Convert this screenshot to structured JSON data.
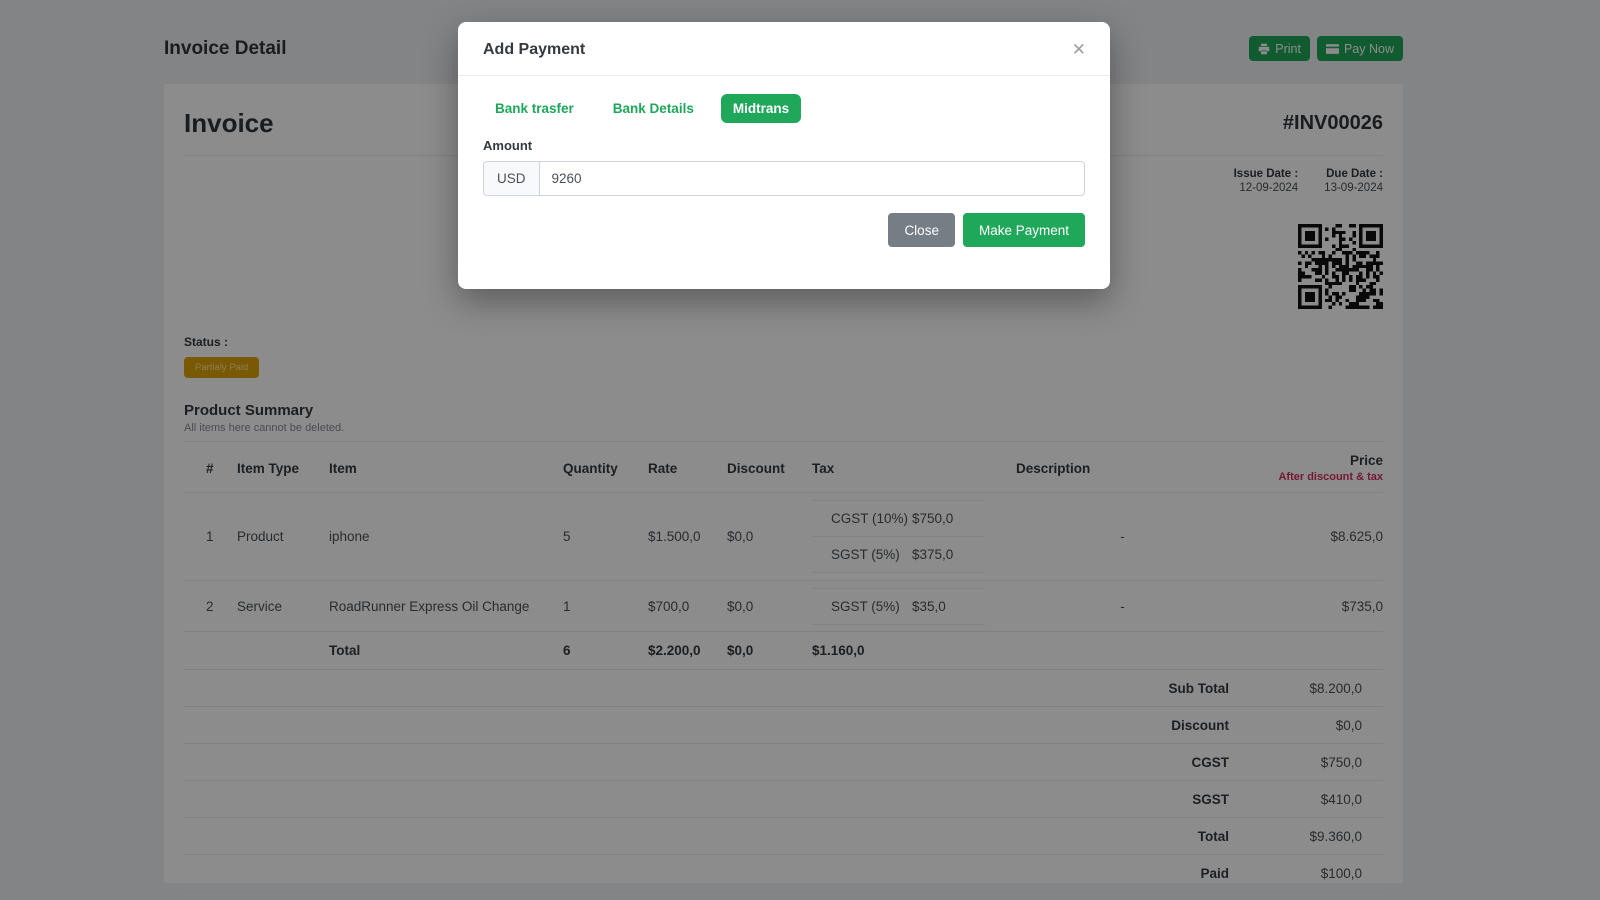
{
  "colors": {
    "accent_green": "#1fa75a",
    "badge_amber": "#dda206",
    "danger_red": "#d63061",
    "backdrop": "rgba(0,0,0,0.45)"
  },
  "page": {
    "title": "Invoice Detail",
    "print_label": "Print",
    "pay_now_label": "Pay Now"
  },
  "modal": {
    "title": "Add Payment",
    "close_icon": "✕",
    "tabs": [
      {
        "label": "Bank trasfer",
        "active": false
      },
      {
        "label": "Bank Details",
        "active": false
      },
      {
        "label": "Midtrans",
        "active": true
      }
    ],
    "amount_label": "Amount",
    "currency": "USD",
    "amount_value": "9260",
    "close_button": "Close",
    "make_payment_button": "Make Payment"
  },
  "invoice": {
    "heading": "Invoice",
    "number": "#INV00026",
    "issue_date_label": "Issue Date :",
    "issue_date": "12-09-2024",
    "due_date_label": "Due Date :",
    "due_date": "13-09-2024",
    "status_label": "Status :",
    "status_badge": "Partialy Paid",
    "section_title": "Product Summary",
    "section_note": "All items here cannot be deleted."
  },
  "table": {
    "headers": {
      "num": "#",
      "item_type": "Item Type",
      "item": "Item",
      "quantity": "Quantity",
      "rate": "Rate",
      "discount": "Discount",
      "tax": "Tax",
      "description": "Description",
      "price": "Price"
    },
    "price_subheader": "After discount & tax",
    "rows": [
      {
        "num": "1",
        "type": "Product",
        "item": "iphone",
        "qty": "5",
        "rate": "$1.500,0",
        "discount": "$0,0",
        "taxes": [
          {
            "name": "CGST (10%)",
            "amount": "$750,0"
          },
          {
            "name": "SGST (5%)",
            "amount": "$375,0"
          }
        ],
        "description": "-",
        "price": "$8.625,0"
      },
      {
        "num": "2",
        "type": "Service",
        "item": "RoadRunner Express Oil Change",
        "qty": "1",
        "rate": "$700,0",
        "discount": "$0,0",
        "taxes": [
          {
            "name": "SGST (5%)",
            "amount": "$35,0"
          }
        ],
        "description": "-",
        "price": "$735,0"
      }
    ],
    "total_row": {
      "label": "Total",
      "qty": "6",
      "rate": "$2.200,0",
      "discount": "$0,0",
      "tax": "$1.160,0"
    },
    "summary": [
      {
        "label": "Sub Total",
        "value": "$8.200,0"
      },
      {
        "label": "Discount",
        "value": "$0,0"
      },
      {
        "label": "CGST",
        "value": "$750,0"
      },
      {
        "label": "SGST",
        "value": "$410,0"
      },
      {
        "label": "Total",
        "value": "$9.360,0"
      },
      {
        "label": "Paid",
        "value": "$100,0"
      }
    ]
  }
}
